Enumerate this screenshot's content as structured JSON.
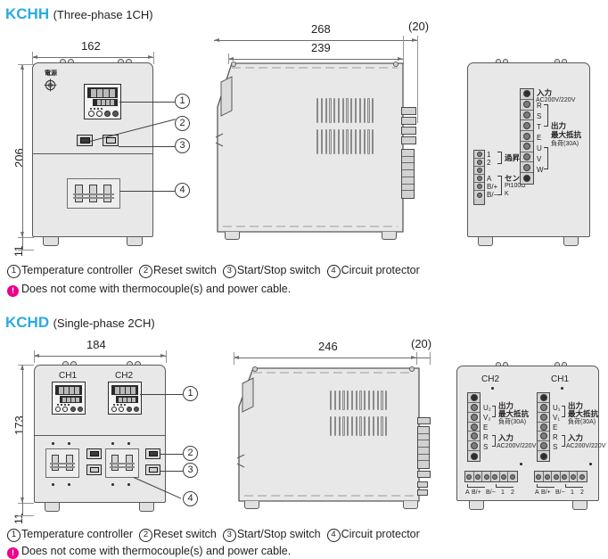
{
  "sections": [
    {
      "id": "kchh",
      "title": "KCHH",
      "subtitle": "(Three-phase 1CH)",
      "title_color": "#29abe2",
      "front": {
        "dim_width": "162",
        "dim_height": "206",
        "dim_foot": "11",
        "power_label": "電源",
        "power_label_name": "power-supply-connector"
      },
      "side": {
        "dim_depth_total": "268",
        "dim_depth_body": "239",
        "dim_terminal": "(20)"
      },
      "rear": {
        "sensor_terminals": [
          {
            "label": "1"
          },
          {
            "label": "2"
          },
          {
            "label": ""
          },
          {
            "label": "A"
          },
          {
            "label": "B/+"
          },
          {
            "label": "B/−"
          }
        ],
        "sensor_group_upper": "過昇",
        "sensor_group_lower_1": "センサ",
        "sensor_group_lower_2": "Pt100Ω",
        "sensor_group_lower_3": "K",
        "power_terminals": [
          {
            "label": "R"
          },
          {
            "label": "S"
          },
          {
            "label": "T"
          },
          {
            "label": "E"
          },
          {
            "label": "U"
          },
          {
            "label": "V"
          },
          {
            "label": "W"
          }
        ],
        "input_title": "入力",
        "input_spec": "AC200V/220V",
        "output_title": "出力",
        "output_spec_1": "最大抵抗",
        "output_spec_2": "負荷(30A)"
      },
      "callouts": [
        "1",
        "2",
        "3",
        "4"
      ],
      "caption_items": [
        {
          "num": "1",
          "text": "Temperature controller"
        },
        {
          "num": "2",
          "text": "Reset switch"
        },
        {
          "num": "3",
          "text": "Start/Stop switch"
        },
        {
          "num": "4",
          "text": "Circuit protector"
        }
      ],
      "note": "Does not come with thermocouple(s) and power cable.",
      "note_icon": "!"
    },
    {
      "id": "kchd",
      "title": "KCHD",
      "subtitle": "(Single-phase 2CH)",
      "title_color": "#29abe2",
      "front": {
        "dim_width": "184",
        "dim_height": "173",
        "dim_foot": "11",
        "ch1_label": "CH1",
        "ch2_label": "CH2"
      },
      "side": {
        "dim_depth_body": "246",
        "dim_terminal": "(20)"
      },
      "rear": {
        "ch2_label": "CH2",
        "ch1_label": "CH1",
        "ch2_terminals": [
          {
            "label": "U₂"
          },
          {
            "label": "V₂"
          },
          {
            "label": "E"
          },
          {
            "label": "R"
          },
          {
            "label": "S"
          }
        ],
        "ch1_terminals": [
          {
            "label": "U₁"
          },
          {
            "label": "V₁"
          },
          {
            "label": "E"
          },
          {
            "label": "R"
          },
          {
            "label": "S"
          }
        ],
        "output_title": "出力",
        "output_spec_1": "最大抵抗",
        "output_spec_2": "負荷(30A)",
        "input_title": "入力",
        "input_spec": "AC200V/220V",
        "bottom_strip_labels": [
          "A",
          "B/+",
          "B/−",
          "1",
          "2"
        ]
      },
      "callouts": [
        "1",
        "2",
        "3",
        "4"
      ],
      "caption_items": [
        {
          "num": "1",
          "text": "Temperature controller"
        },
        {
          "num": "2",
          "text": "Reset switch"
        },
        {
          "num": "3",
          "text": "Start/Stop switch"
        },
        {
          "num": "4",
          "text": "Circuit protector"
        }
      ],
      "note": "Does not come with thermocouple(s) and power cable.",
      "note_icon": "!"
    }
  ]
}
